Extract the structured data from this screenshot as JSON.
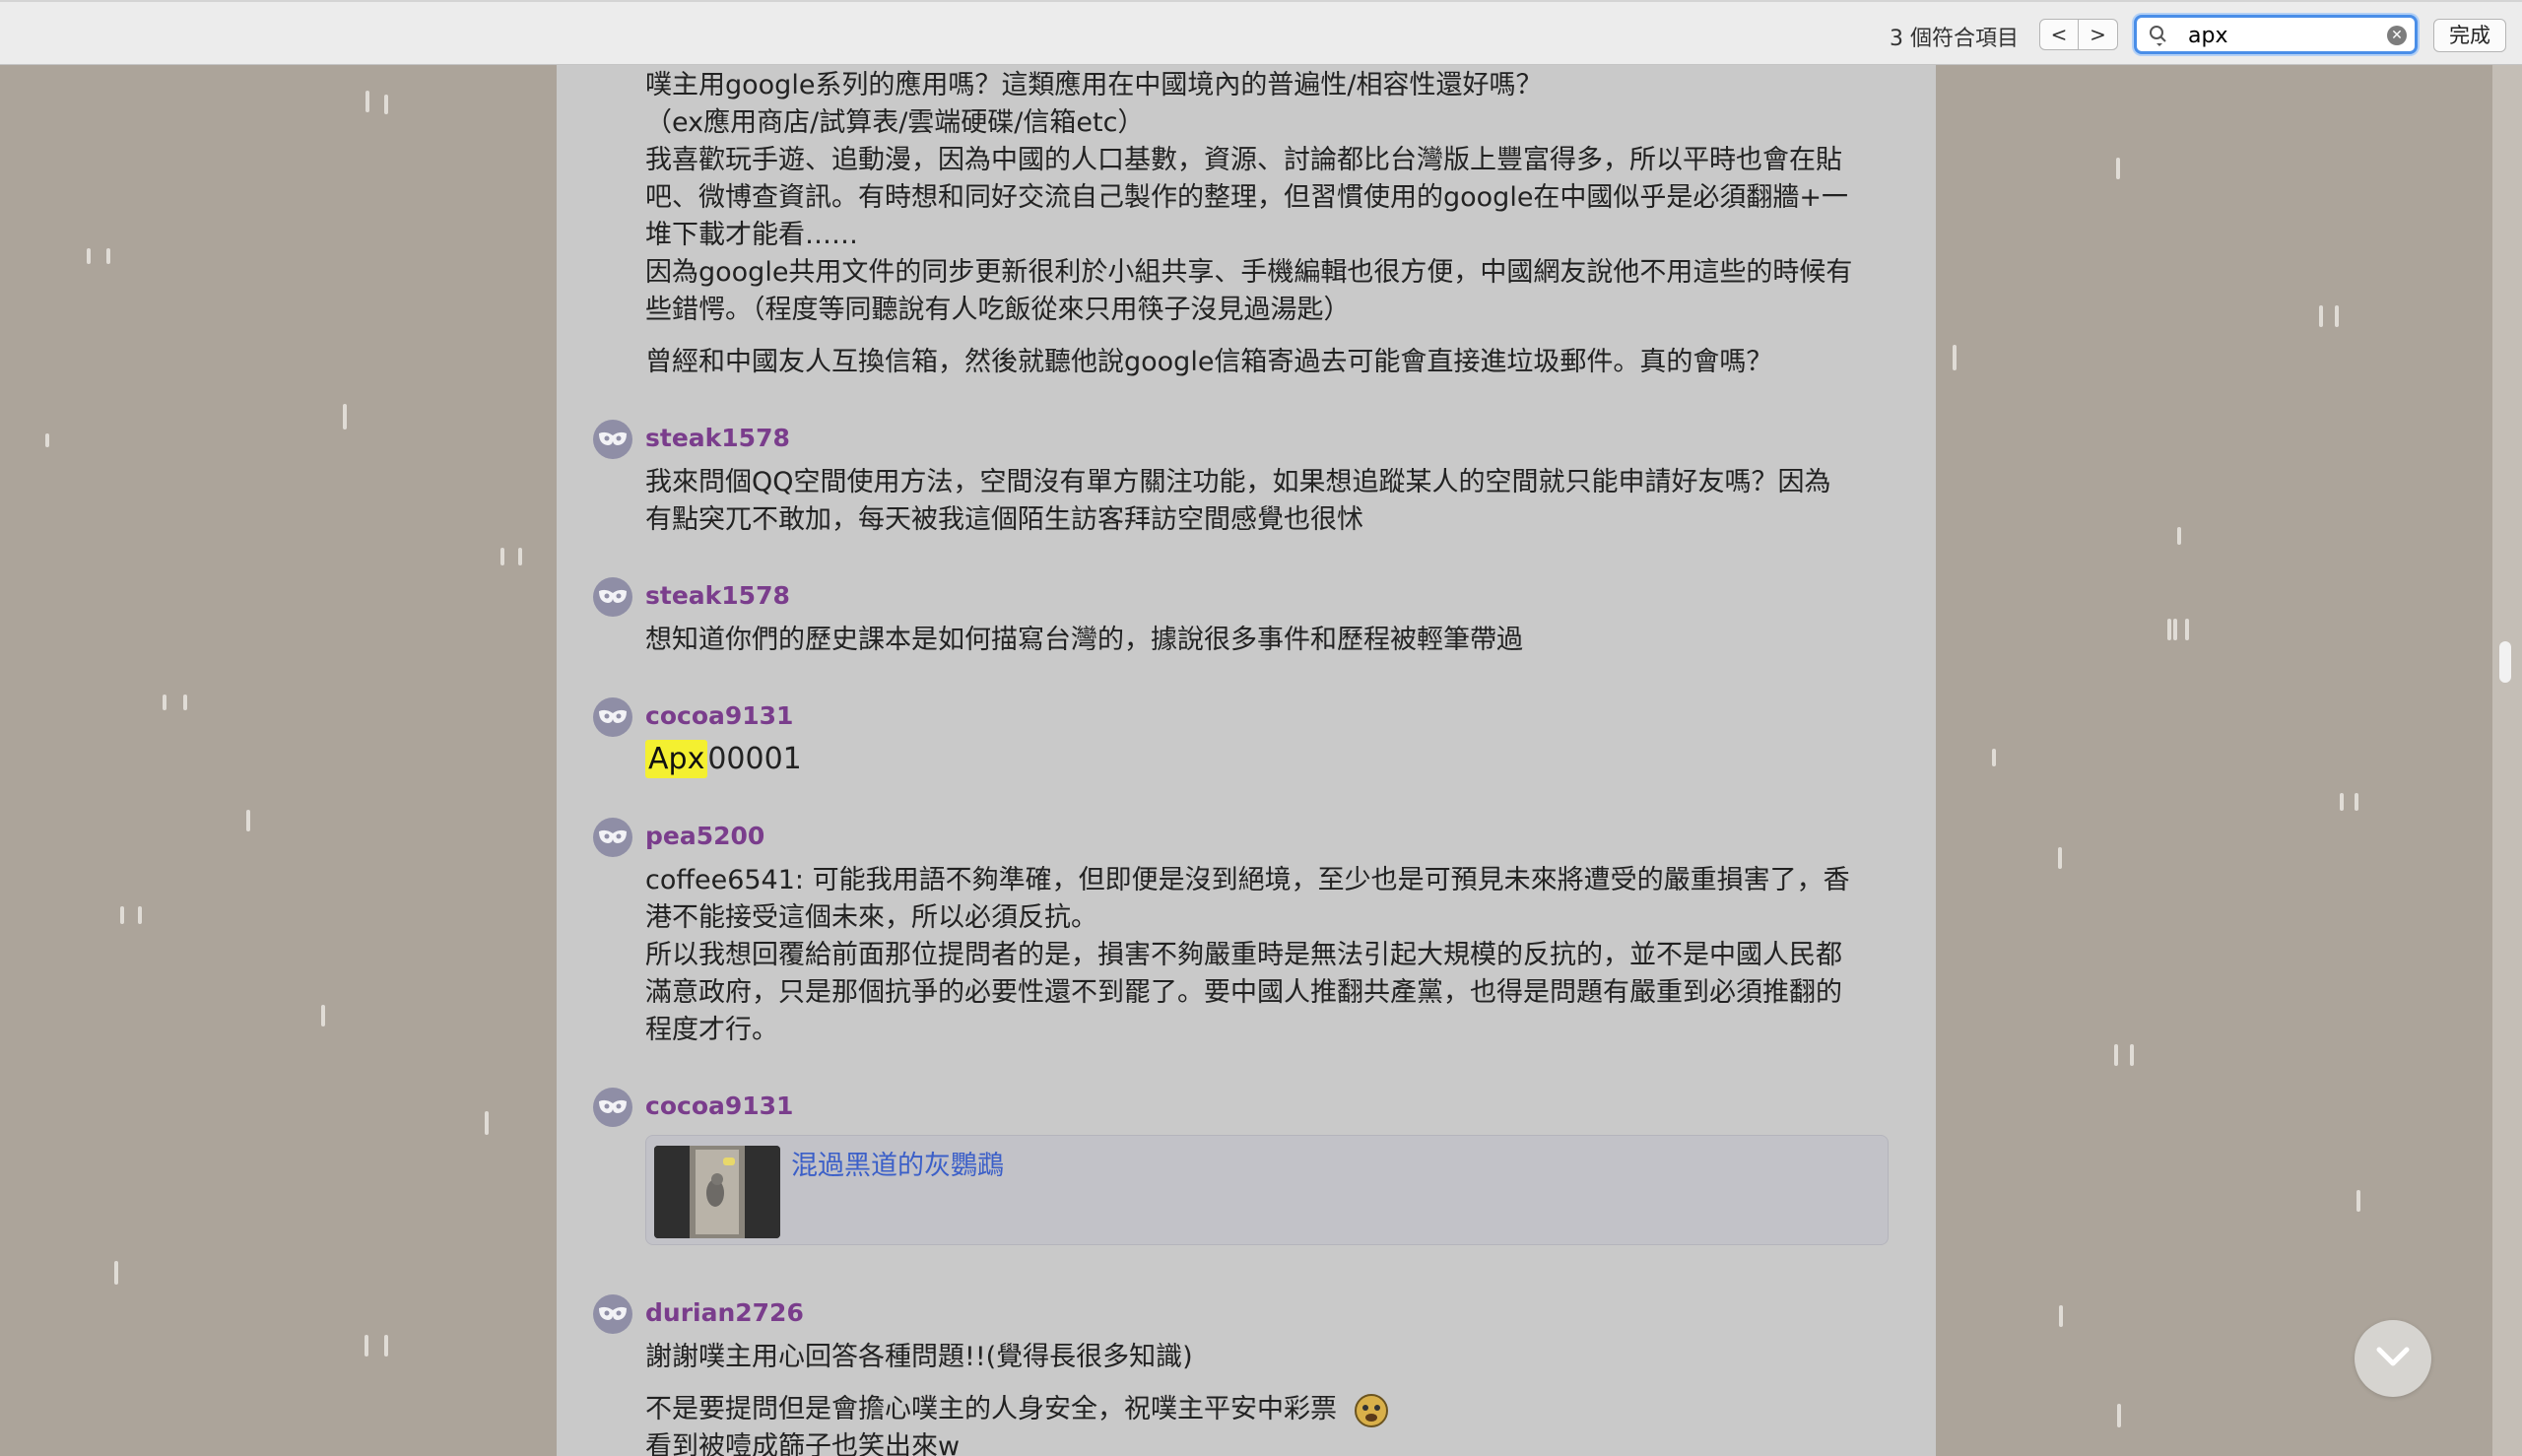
{
  "find_bar": {
    "match_count": "3 個符合項目",
    "prev_label": "<",
    "next_label": ">",
    "query": "apx",
    "done_label": "完成"
  },
  "posts": {
    "p1": {
      "lines": [
        "噗主用google系列的應用嗎？這類應用在中國境內的普遍性/相容性還好嗎？",
        "（ex應用商店/試算表/雲端硬碟/信箱etc）",
        "我喜歡玩手遊、追動漫，因為中國的人口基數，資源、討論都比台灣版上豐富得多，所以平時也會在貼",
        "吧、微博查資訊。有時想和同好交流自己製作的整理，但習慣使用的google在中國似乎是必須翻牆+一",
        "堆下載才能看……",
        "因為google共用文件的同步更新很利於小組共享、手機編輯也很方便，中國網友說他不用這些的時候有",
        "些錯愕。（程度等同聽說有人吃飯從來只用筷子沒見過湯匙）",
        "曾經和中國友人互換信箱，然後就聽他說google信箱寄過去可能會直接進垃圾郵件。真的會嗎？"
      ]
    },
    "p2": {
      "user": "steak1578",
      "lines": [
        "我來問個QQ空間使用方法，空間沒有單方關注功能，如果想追蹤某人的空間就只能申請好友嗎？因為",
        "有點突兀不敢加，每天被我這個陌生訪客拜訪空間感覺也很怵"
      ]
    },
    "p3": {
      "user": "steak1578",
      "lines": [
        "想知道你們的歷史課本是如何描寫台灣的，據說很多事件和歷程被輕筆帶過"
      ]
    },
    "p4": {
      "user": "cocoa9131",
      "highlight": "Apx",
      "rest": "00001"
    },
    "p5": {
      "user": "pea5200",
      "lines": [
        "coffee6541: 可能我用語不夠準確，但即便是沒到絕境，至少也是可預見未來將遭受的嚴重損害了，香",
        "港不能接受這個未來，所以必須反抗。",
        "所以我想回覆給前面那位提問者的是，損害不夠嚴重時是無法引起大規模的反抗的，並不是中國人民都",
        "滿意政府，只是那個抗爭的必要性還不到罷了。要中國人推翻共產黨，也得是問題有嚴重到必須推翻的",
        "程度才行。"
      ]
    },
    "p6": {
      "user": "cocoa9131",
      "card_title": "混過黑道的灰鸚鵡"
    },
    "p7": {
      "user": "durian2726",
      "lines": [
        "謝謝噗主用心回答各種問題!!(覺得長很多知識)",
        "不是要提問但是會擔心噗主的人身安全，祝噗主平安中彩票",
        "看到被噎成篩子也笑出來w"
      ]
    }
  }
}
